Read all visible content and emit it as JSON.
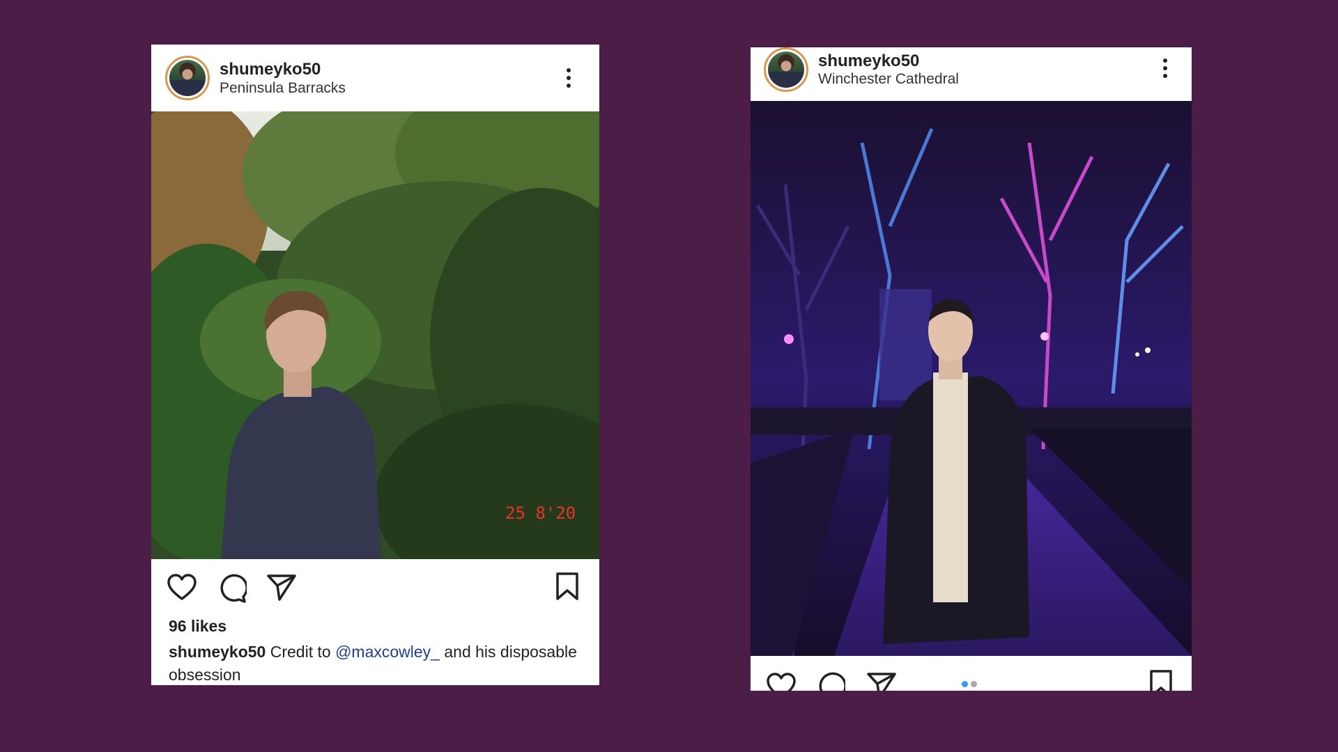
{
  "colors": {
    "background": "#4c1d47",
    "card": "#ffffff",
    "mention": "#1f3f86",
    "dot_active": "#3897f0",
    "dot_inactive": "#a8a8a8",
    "timestamp": "#e8322a"
  },
  "posts": [
    {
      "username": "shumeyko50",
      "location": "Peninsula Barracks",
      "photo_stamp": "25  8'20",
      "likes": "96 likes",
      "caption": {
        "user": "shumeyko50",
        "text_before": " Credit to ",
        "mention": "@maxcowley_",
        "text_after": " and his disposable obsession"
      },
      "icons": [
        "heart-icon",
        "comment-icon",
        "share-icon",
        "bookmark-icon",
        "more-icon"
      ]
    },
    {
      "username": "shumeyko50",
      "location": "Winchester Cathedral",
      "carousel": {
        "count": 2,
        "active": 0
      },
      "icons": [
        "heart-icon",
        "comment-icon",
        "share-icon",
        "bookmark-icon",
        "more-icon"
      ]
    }
  ]
}
